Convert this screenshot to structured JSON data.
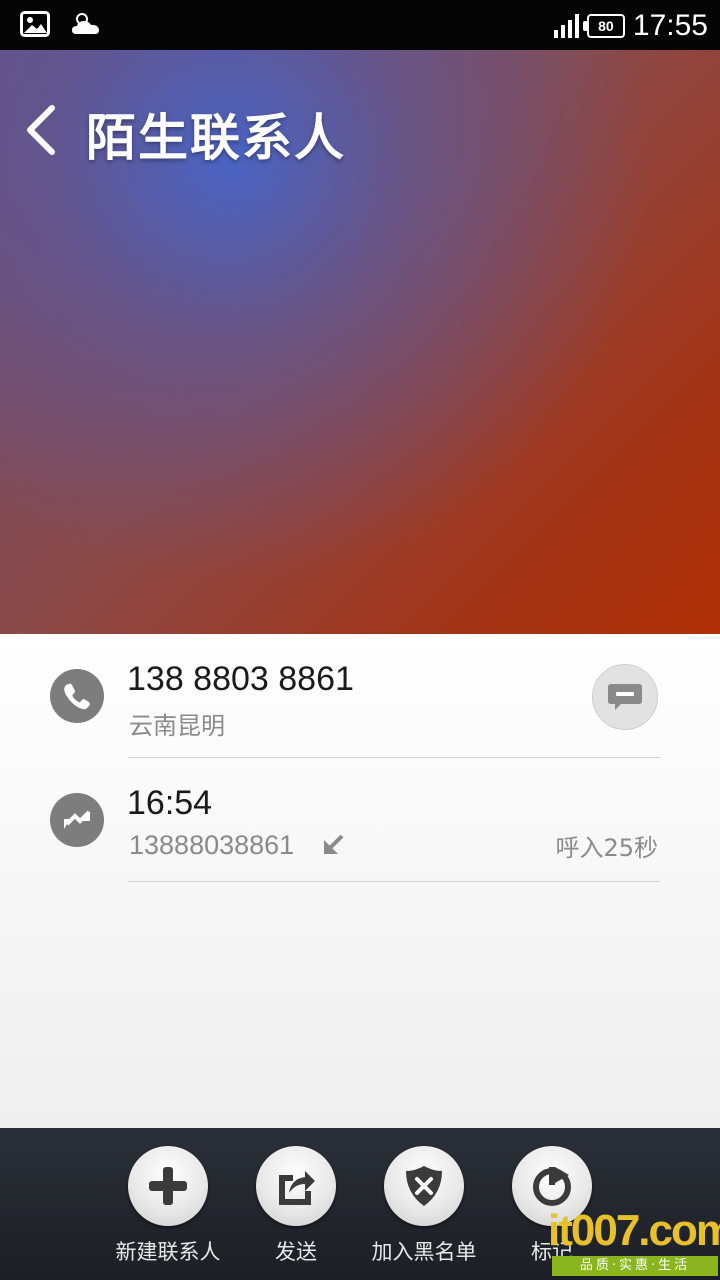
{
  "status_bar": {
    "time": "17:55",
    "battery": "80",
    "icons": [
      "gallery-icon",
      "weather-cloudy-icon",
      "signal-icon",
      "battery-icon"
    ]
  },
  "header": {
    "title": "陌生联系人",
    "back_icon": "chevron-left-icon"
  },
  "contact": {
    "phone_number": "138 8803 8861",
    "location": "云南昆明",
    "message_icon": "message-icon"
  },
  "call_log": [
    {
      "time": "16:54",
      "number": "13888038861",
      "direction_icon": "incoming-arrow-icon",
      "duration": "呼入25秒"
    }
  ],
  "actions": [
    {
      "label": "新建联系人",
      "icon": "plus-icon"
    },
    {
      "label": "发送",
      "icon": "share-icon"
    },
    {
      "label": "加入黑名单",
      "icon": "shield-x-icon"
    },
    {
      "label": "标记",
      "icon": "tag-icon"
    }
  ],
  "watermark": {
    "logo": "it007.com",
    "tagline": "品质·实惠·生活"
  },
  "colors": {
    "hero_blue": "#4664c8",
    "hero_orange": "#b02f05",
    "icon_gray": "#7d7d7d",
    "bottom_bar": "#2b2f37"
  }
}
